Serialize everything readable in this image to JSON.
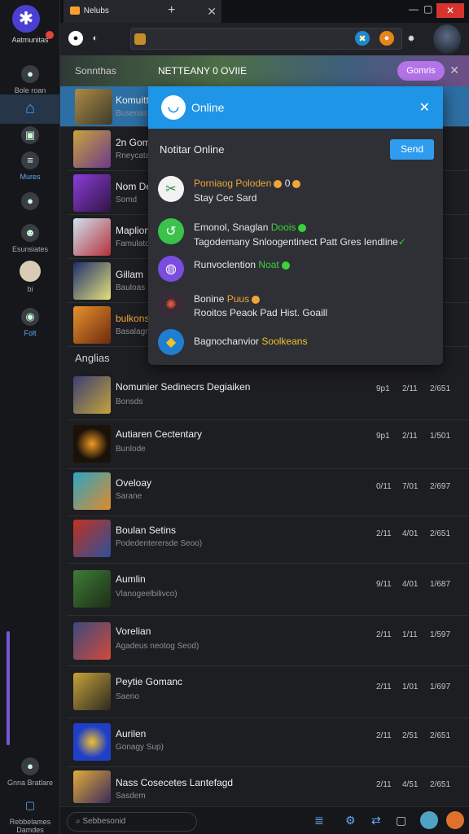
{
  "app": {
    "name": "Aatmunitas",
    "tab_title": "Nelubs"
  },
  "sidebar": {
    "items": [
      {
        "label": "Bole roan",
        "icon": "user-icon"
      },
      {
        "label": "",
        "icon": "home-icon"
      },
      {
        "label": "",
        "icon": "box-icon"
      },
      {
        "label": "Mures",
        "icon": "menu-icon"
      },
      {
        "label": "",
        "icon": "chat-icon"
      },
      {
        "label": "Esunsiates",
        "icon": "discord-icon"
      },
      {
        "label": "bi",
        "icon": "avatar-icon"
      },
      {
        "label": "Folt",
        "icon": "controller-icon"
      }
    ],
    "bottom": [
      {
        "label": "Gnna Bratlare"
      },
      {
        "label": "Rebbelames Damdes"
      }
    ]
  },
  "banner": {
    "section": "Sonnthas",
    "title": "NETTEANY 0 OVIIE",
    "button": "Gomris"
  },
  "list_top": [
    {
      "name": "Komuitt",
      "sub": "Busenas"
    },
    {
      "name": "2n Gomr",
      "sub": "Rneycatalce"
    },
    {
      "name": "Nom De",
      "sub": "Somd"
    },
    {
      "name": "Maplion",
      "sub": "Famulatom"
    },
    {
      "name": "Gillam",
      "sub": "Bauloas"
    },
    {
      "name": "bulkons",
      "sub": "Basalagnas"
    }
  ],
  "section_title": "Anglias",
  "list": [
    {
      "name": "Nomunier Sedinecrs Degiaiken",
      "sub": "Bonsds",
      "c1": "9p1",
      "c2": "2/11",
      "c3": "2/651"
    },
    {
      "name": "Autiaren Cectentary",
      "sub": "Bunlode",
      "c1": "9p1",
      "c2": "2/11",
      "c3": "1/501"
    },
    {
      "name": "Oveloay",
      "sub": "Sarane",
      "c1": "0/11",
      "c2": "7/01",
      "c3": "2/697"
    },
    {
      "name": "Boulan Setins",
      "sub": "Podedenterersde Seoo)",
      "c1": "2/11",
      "c2": "4/01",
      "c3": "2/651"
    },
    {
      "name": "Aumlin",
      "sub": "Vlanogeelbilivco)",
      "c1": "9/11",
      "c2": "4/01",
      "c3": "1/687"
    },
    {
      "name": "Vorelian",
      "sub": "Agadeus neotog Seod)",
      "c1": "2/11",
      "c2": "1/11",
      "c3": "1/597"
    },
    {
      "name": "Peytie Gomanc",
      "sub": "Saeno",
      "c1": "2/11",
      "c2": "1/01",
      "c3": "1/697"
    },
    {
      "name": "Aurilen",
      "sub": "Gonagy Sup)",
      "c1": "2/11",
      "c2": "2/51",
      "c3": "2/651"
    },
    {
      "name": "Nass Cosecetes Lantefagd",
      "sub": "Sasdem",
      "c1": "2/11",
      "c2": "4/51",
      "c3": "2/651"
    }
  ],
  "modal": {
    "title": "Online",
    "label": "Notitar Online",
    "send": "Send",
    "items": [
      {
        "title": "Porniaog Poloden",
        "tag": "0",
        "line2": "Stay Cec Sard"
      },
      {
        "title": "Emonol, Snaglan",
        "tag": "Doois",
        "line2": "Tagodemany Snloogentinect Patt Gres Iendline"
      },
      {
        "title": "Runvoclention",
        "tag": "Noat",
        "line2": ""
      },
      {
        "title": "Bonine",
        "tag": "Puus",
        "line2": "Rooitos Peaok Pad Hist. Goaill"
      },
      {
        "title": "Bagnochanvior",
        "tag": "Soolkeans",
        "line2": ""
      }
    ]
  },
  "footer": {
    "search_placeholder": "Sebbesonid"
  }
}
